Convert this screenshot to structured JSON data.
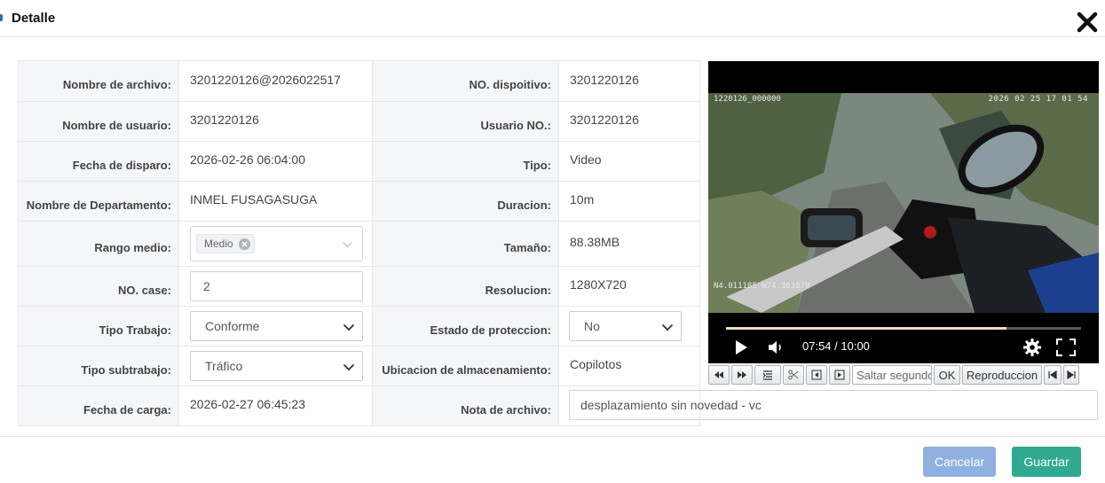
{
  "dialog": {
    "title": "Detalle"
  },
  "fields": {
    "file_name": {
      "label": "Nombre de archivo:",
      "value": "3201220126@2026022517"
    },
    "device_no": {
      "label": "NO. dispoitivo:",
      "value": "3201220126"
    },
    "user_name": {
      "label": "Nombre de usuario:",
      "value": "3201220126"
    },
    "user_no": {
      "label": "Usuario NO.:",
      "value": "3201220126"
    },
    "shot_date": {
      "label": "Fecha de disparo:",
      "value": "2026-02-26 06:04:00"
    },
    "type": {
      "label": "Tipo:",
      "value": "Video"
    },
    "department": {
      "label": "Nombre de Departamento:",
      "value": "INMEL FUSAGASUGA"
    },
    "duration": {
      "label": "Duracion:",
      "value": "10m"
    },
    "range": {
      "label": "Rango medio:",
      "tag": "Medio"
    },
    "size": {
      "label": "Tamaño:",
      "value": "88.38MB"
    },
    "case_no": {
      "label": "NO. case:",
      "value": "2"
    },
    "resolution": {
      "label": "Resolucion:",
      "value": "1280X720"
    },
    "work_type": {
      "label": "Tipo Trabajo:",
      "value": "Conforme"
    },
    "protection": {
      "label": "Estado de proteccion:",
      "value": "No"
    },
    "work_subtype": {
      "label": "Tipo subtrabajo:",
      "value": "Tráfico"
    },
    "storage": {
      "label": "Ubicacion de almacenamiento:",
      "value": "Copilotos"
    },
    "upload_date": {
      "label": "Fecha de carga:",
      "value": "2026-02-27 06:45:23"
    },
    "note": {
      "label": "Nota de archivo:",
      "value": "desplazamiento sin novedad - vc"
    }
  },
  "video": {
    "osd_top_left": "1220126_000000",
    "osd_top_right": "2026 02 25 17 01 54",
    "osd_bottom_left": "N4.011185 W74.363879",
    "time": "07:54 / 10:00",
    "progress": 0.79
  },
  "toolbar": {
    "seek_placeholder": "Saltar segundos",
    "ok": "OK",
    "play_label": "Reproduccion"
  },
  "footer": {
    "cancel": "Cancelar",
    "save": "Guardar"
  },
  "colors": {
    "save": "#2fa98f",
    "cancel": "#8fb0e0",
    "label_bg": "#f5f6f8"
  }
}
